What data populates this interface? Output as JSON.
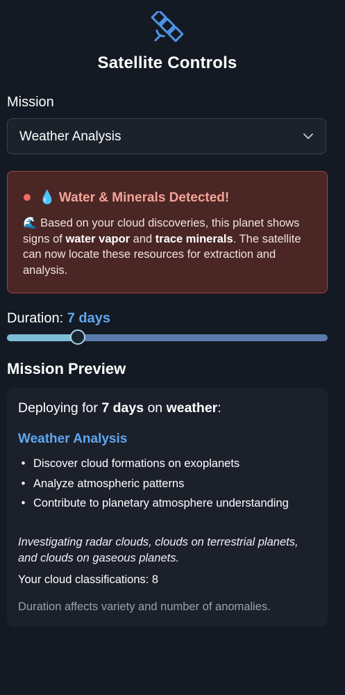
{
  "header": {
    "icon": "satellite-icon",
    "title": "Satellite Controls"
  },
  "mission": {
    "label": "Mission",
    "selected": "Weather Analysis"
  },
  "alert": {
    "title": "💧 Water & Minerals Detected!",
    "body_prefix": "🌊 Based on your cloud discoveries, this planet shows signs of ",
    "bold1": "water vapor",
    "mid": " and ",
    "bold2": "trace minerals",
    "body_suffix": ". The satellite can now locate these resources for extraction and analysis.",
    "accent_color": "#f26b65"
  },
  "duration": {
    "label": "Duration:",
    "value_text": "7 days",
    "fraction": 0.22
  },
  "preview": {
    "heading": "Mission Preview",
    "deploy_prefix": "Deploying for ",
    "deploy_days": "7 days",
    "deploy_mid": " on ",
    "deploy_type": "weather",
    "deploy_suffix": ":",
    "subtitle": "Weather Analysis",
    "bullets": [
      "Discover cloud formations on exoplanets",
      "Analyze atmospheric patterns",
      "Contribute to planetary atmosphere understanding"
    ],
    "note": "Investigating radar clouds, clouds on terrestrial planets, and clouds on gaseous planets.",
    "classifications": "Your cloud classifications: 8",
    "footnote": "Duration affects variety and number of anomalies."
  },
  "colors": {
    "background": "#141a23",
    "accent_blue": "#5ea7f0",
    "card": "#1b202b"
  }
}
